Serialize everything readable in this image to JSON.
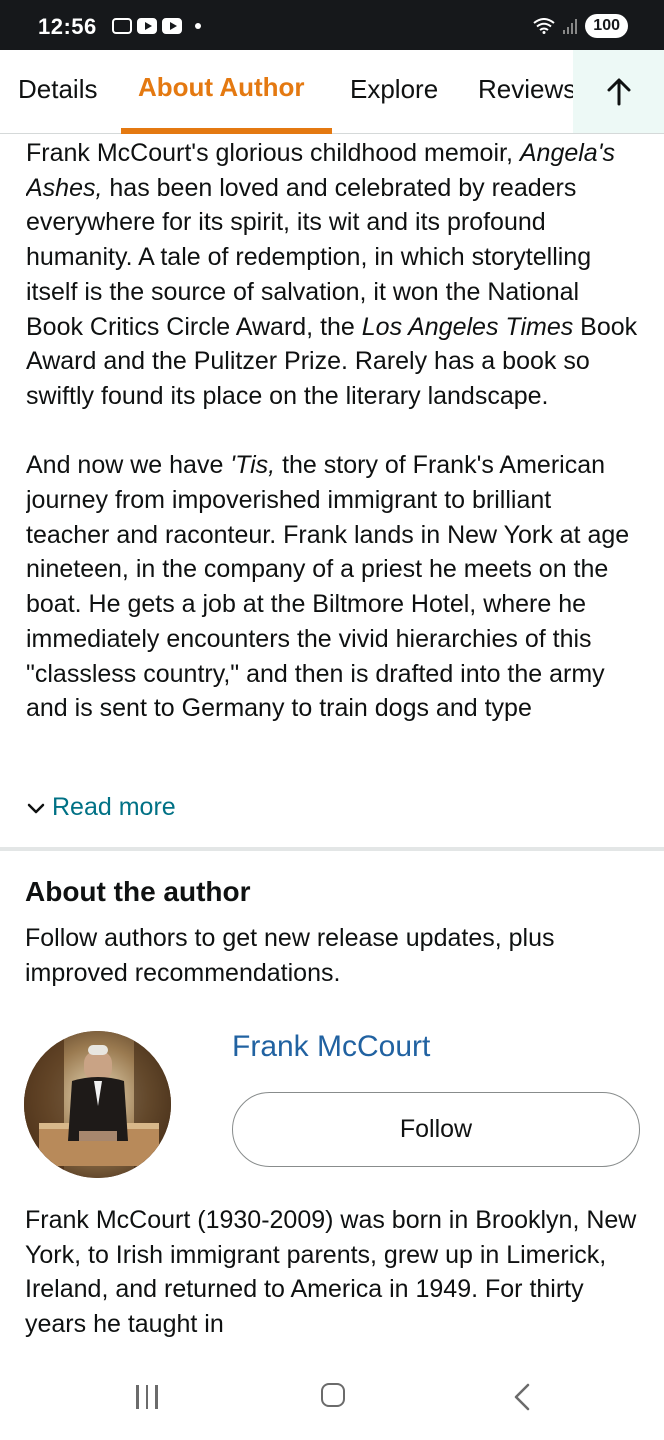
{
  "status_bar": {
    "time": "12:56",
    "battery": "100",
    "icons": [
      "screenshot-icon",
      "youtube-icon",
      "youtube-icon",
      "dot-icon",
      "wifi-icon",
      "signal-icon",
      "battery-icon"
    ]
  },
  "tabs": [
    {
      "label": "Details",
      "active": false
    },
    {
      "label": "About Author",
      "active": true
    },
    {
      "label": "Explore",
      "active": false
    },
    {
      "label": "Reviews",
      "active": false
    }
  ],
  "accent_color": "#e47911",
  "link_color": "#007185",
  "description": {
    "p1_a": "Frank McCourt's glorious childhood memoir, ",
    "p1_title": "Angela's Ashes,",
    "p1_b": " has been loved and celebrated by readers everywhere for its spirit, its wit and its profound humanity. A tale of redemption, in which storytelling itself is the source of salvation, it won the National Book Critics Circle Award, the ",
    "p1_paper": "Los Angeles Times",
    "p1_c": " Book Award and the Pulitzer Prize. Rarely has a book so swiftly found its place on the literary landscape.",
    "p2_a": "And now we have ",
    "p2_title": "'Tis,",
    "p2_b": " the story of Frank's American journey from impoverished immigrant to brilliant teacher and raconteur. Frank lands in New York at age nineteen, in the company of a priest he meets on the boat. He gets a job at the Biltmore Hotel, where he immediately encounters the vivid hierarchies of this \"classless country,\" and then is drafted into the army and is sent to Germany to train dogs and type",
    "read_more": "Read more"
  },
  "about": {
    "heading": "About the author",
    "subtitle": "Follow authors to get new release updates, plus improved recommendations.",
    "author_name": "Frank McCourt",
    "follow_label": "Follow",
    "bio": "Frank McCourt (1930-2009) was born in Brooklyn, New York, to Irish immigrant parents, grew up in Limerick, Ireland, and returned to America in 1949. For thirty years he taught in"
  },
  "nav": {
    "icons": [
      "recent-apps-icon",
      "home-icon",
      "back-icon"
    ]
  }
}
